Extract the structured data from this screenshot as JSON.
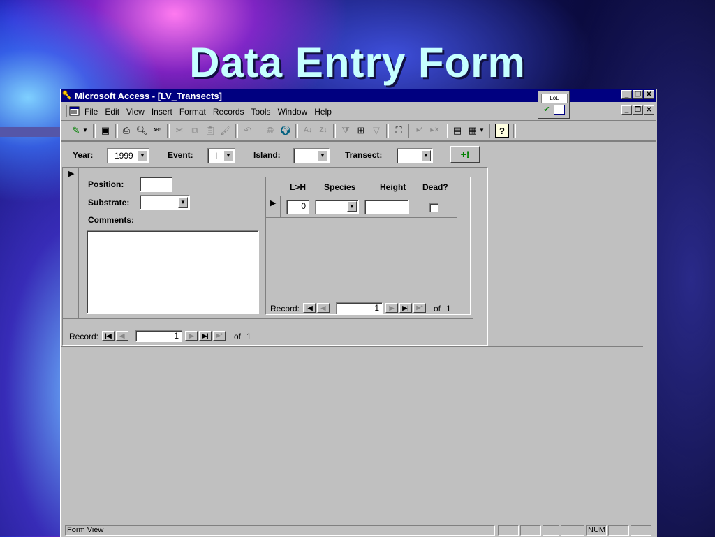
{
  "slide": {
    "title": "Data Entry Form"
  },
  "window": {
    "title": "Microsoft Access - [LV_Transects]",
    "caption_buttons": {
      "minimize": "_",
      "restore": "❐",
      "close": "✕"
    }
  },
  "menu": [
    "File",
    "Edit",
    "View",
    "Insert",
    "Format",
    "Records",
    "Tools",
    "Window",
    "Help"
  ],
  "floater": {
    "label": "LoL"
  },
  "header": {
    "year_label": "Year:",
    "year_value": "1999",
    "event_label": "Event:",
    "event_value": "I",
    "island_label": "Island:",
    "island_value": "",
    "transect_label": "Transect:",
    "transect_value": "",
    "add_button": "+!"
  },
  "detail": {
    "position_label": "Position:",
    "position_value": "",
    "substrate_label": "Substrate:",
    "substrate_value": "",
    "comments_label": "Comments:",
    "comments_value": ""
  },
  "subform": {
    "columns": [
      "L>H",
      "Species",
      "Height",
      "Dead?"
    ],
    "row": {
      "lh": "0",
      "species": "",
      "height": "",
      "dead": false
    },
    "nav": {
      "record_label": "Record:",
      "current": "1",
      "of_label": "of",
      "total": "1"
    }
  },
  "main_nav": {
    "record_label": "Record:",
    "current": "1",
    "of_label": "of",
    "total": "1"
  },
  "status": {
    "text": "Form View",
    "num": "NUM"
  }
}
